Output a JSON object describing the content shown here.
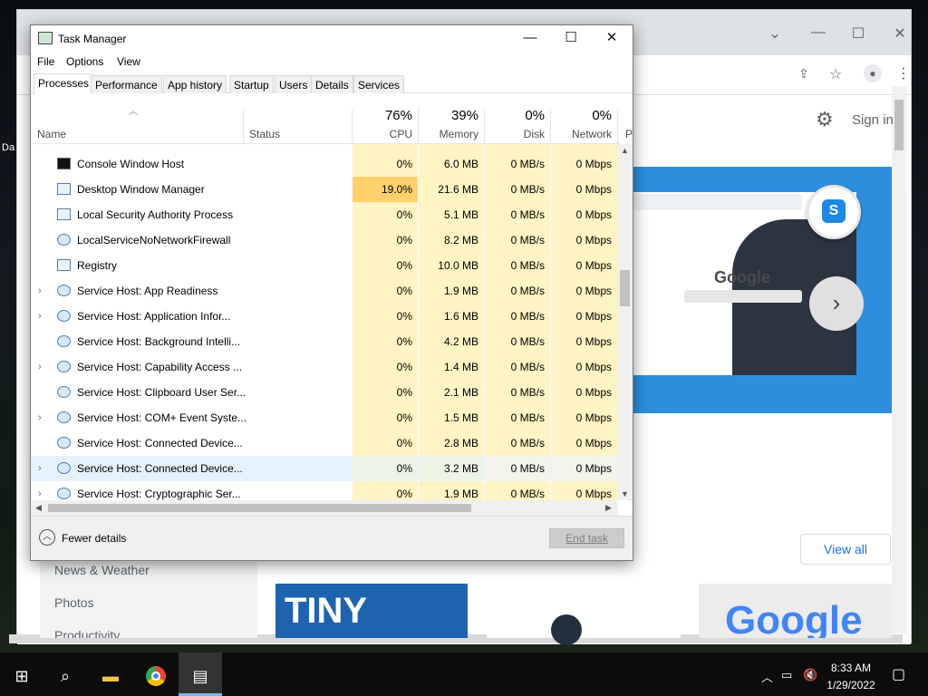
{
  "desktop": {
    "icon_label": "Da"
  },
  "chrome": {
    "signin": "Sign in",
    "slide_logo": "Google",
    "view_all": "View all",
    "sidebar_items": [
      "News & Weather",
      "Photos",
      "Productivity"
    ],
    "thumb_tiny": "TINY",
    "thumb_google": "Google"
  },
  "taskmanager": {
    "title": "Task Manager",
    "menu": [
      "File",
      "Options",
      "View"
    ],
    "tabs": [
      "Processes",
      "Performance",
      "App history",
      "Startup",
      "Users",
      "Details",
      "Services"
    ],
    "active_tab": "Processes",
    "columns": {
      "name": "Name",
      "status": "Status",
      "cpu": {
        "pct": "76%",
        "label": "CPU"
      },
      "memory": {
        "pct": "39%",
        "label": "Memory"
      },
      "disk": {
        "pct": "0%",
        "label": "Disk"
      },
      "network": {
        "pct": "0%",
        "label": "Network"
      },
      "power_initial": "P"
    },
    "rows": [
      {
        "name": "Console Window Host",
        "icon": "console-icon",
        "expandable": false,
        "cpu": "0%",
        "memory": "6.0 MB",
        "disk": "0 MB/s",
        "network": "0 Mbps",
        "highlight": false,
        "selected": false
      },
      {
        "name": "Desktop Window Manager",
        "icon": "window-icon",
        "expandable": false,
        "cpu": "19.0%",
        "memory": "21.6 MB",
        "disk": "0 MB/s",
        "network": "0 Mbps",
        "highlight": true,
        "selected": false
      },
      {
        "name": "Local Security Authority Process",
        "icon": "window-icon",
        "expandable": false,
        "cpu": "0%",
        "memory": "5.1 MB",
        "disk": "0 MB/s",
        "network": "0 Mbps",
        "highlight": false,
        "selected": false
      },
      {
        "name": "LocalServiceNoNetworkFirewall",
        "icon": "gear-icon",
        "expandable": false,
        "cpu": "0%",
        "memory": "8.2 MB",
        "disk": "0 MB/s",
        "network": "0 Mbps",
        "highlight": false,
        "selected": false
      },
      {
        "name": "Registry",
        "icon": "window-icon",
        "expandable": false,
        "cpu": "0%",
        "memory": "10.0 MB",
        "disk": "0 MB/s",
        "network": "0 Mbps",
        "highlight": false,
        "selected": false
      },
      {
        "name": "Service Host: App Readiness",
        "icon": "gear-icon",
        "expandable": true,
        "cpu": "0%",
        "memory": "1.9 MB",
        "disk": "0 MB/s",
        "network": "0 Mbps",
        "highlight": false,
        "selected": false
      },
      {
        "name": "Service Host: Application Infor...",
        "icon": "gear-icon",
        "expandable": true,
        "cpu": "0%",
        "memory": "1.6 MB",
        "disk": "0 MB/s",
        "network": "0 Mbps",
        "highlight": false,
        "selected": false
      },
      {
        "name": "Service Host: Background Intelli...",
        "icon": "gear-icon",
        "expandable": false,
        "cpu": "0%",
        "memory": "4.2 MB",
        "disk": "0 MB/s",
        "network": "0 Mbps",
        "highlight": false,
        "selected": false
      },
      {
        "name": "Service Host: Capability Access ...",
        "icon": "gear-icon",
        "expandable": true,
        "cpu": "0%",
        "memory": "1.4 MB",
        "disk": "0 MB/s",
        "network": "0 Mbps",
        "highlight": false,
        "selected": false
      },
      {
        "name": "Service Host: Clipboard User Ser...",
        "icon": "gear-icon",
        "expandable": false,
        "cpu": "0%",
        "memory": "2.1 MB",
        "disk": "0 MB/s",
        "network": "0 Mbps",
        "highlight": false,
        "selected": false
      },
      {
        "name": "Service Host: COM+ Event Syste...",
        "icon": "gear-icon",
        "expandable": true,
        "cpu": "0%",
        "memory": "1.5 MB",
        "disk": "0 MB/s",
        "network": "0 Mbps",
        "highlight": false,
        "selected": false
      },
      {
        "name": "Service Host: Connected Device...",
        "icon": "gear-icon",
        "expandable": false,
        "cpu": "0%",
        "memory": "2.8 MB",
        "disk": "0 MB/s",
        "network": "0 Mbps",
        "highlight": false,
        "selected": false
      },
      {
        "name": "Service Host: Connected Device...",
        "icon": "gear-icon",
        "expandable": true,
        "cpu": "0%",
        "memory": "3.2 MB",
        "disk": "0 MB/s",
        "network": "0 Mbps",
        "highlight": false,
        "selected": true
      },
      {
        "name": "Service Host: Cryptographic Ser...",
        "icon": "gear-icon",
        "expandable": true,
        "cpu": "0%",
        "memory": "1.9 MB",
        "disk": "0 MB/s",
        "network": "0 Mbps",
        "highlight": false,
        "selected": false
      }
    ],
    "fewer_details": "Fewer details",
    "end_task": "End task"
  },
  "taskbar": {
    "time": "8:33 AM",
    "date": "1/29/2022"
  },
  "colors": {
    "cpu_highlight": "#ffd16b",
    "usage_fill": "#fff4c4",
    "selected_row": "#e5f1fb"
  }
}
